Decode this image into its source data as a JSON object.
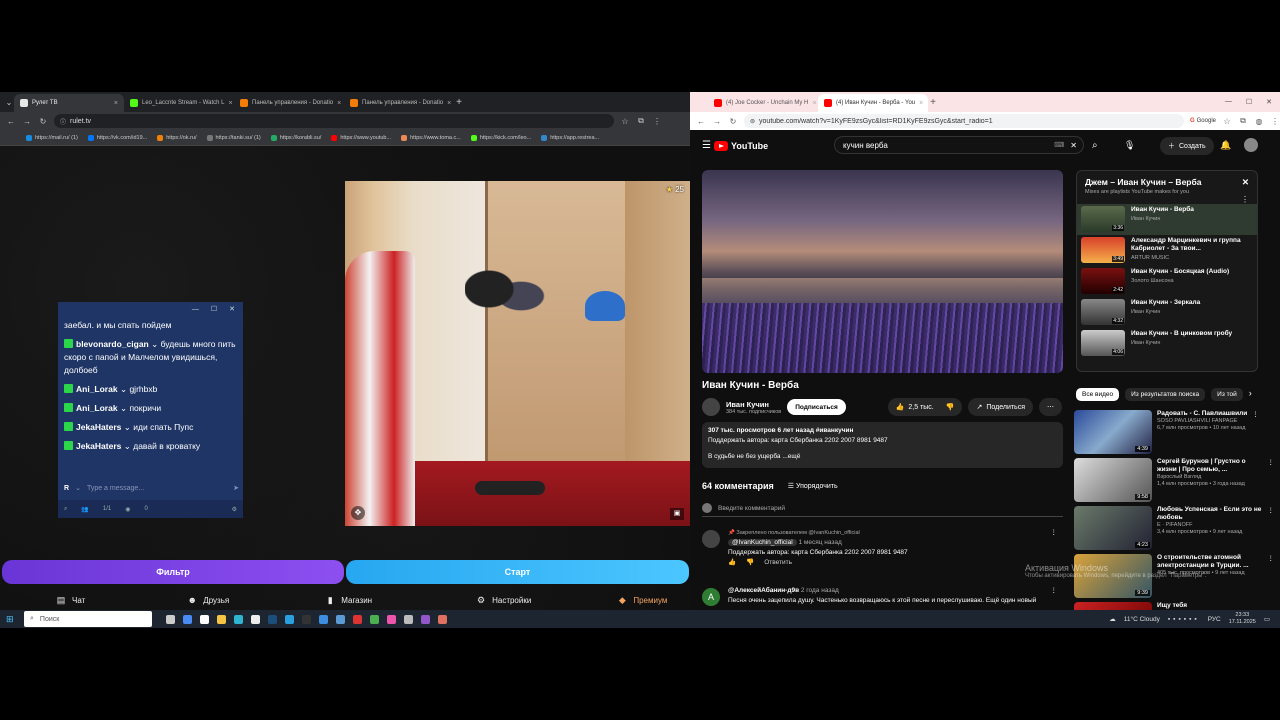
{
  "left_browser": {
    "tabs": [
      {
        "label": "Рулет ТВ",
        "color": "#e8e8e8"
      },
      {
        "label": "Leo_Laccnte Stream - Watch L",
        "color": "#53fc18"
      },
      {
        "label": "Панель управления - Donatio",
        "color": "#f57d07"
      },
      {
        "label": "Панель управления - Donatio",
        "color": "#f57d07"
      }
    ],
    "url": "rulet.tv",
    "bookmarks": [
      "https://mail.ru/ (1)",
      "https://vk.com/id19...",
      "https://ok.ru/",
      "https://tanki.su/ (1)",
      "https://korabli.su/",
      "https://www.youtub...",
      "https://www.toma.c...",
      "https://kick.com/leo...",
      "https://app.restrea..."
    ],
    "chat": {
      "messages": [
        {
          "user": "",
          "text": "заебал. и мы спать пойдем"
        },
        {
          "user": "blevonardo_cigan",
          "text": "будешь много пить скоро с папой и Малчелом увидишься, долбоеб"
        },
        {
          "user": "Ani_Lorak",
          "text": "gjrhbxb"
        },
        {
          "user": "Ani_Lorak",
          "text": "покричи"
        },
        {
          "user": "JekaHaters",
          "text": "иди спать Пупс"
        },
        {
          "user": "JekaHaters",
          "text": "давай в кроватку"
        }
      ],
      "input_badge": "R",
      "input_placeholder": "Type a message...",
      "viewers_count": "1/1",
      "eye_count": "0"
    },
    "video_star_count": "25",
    "btn_filter": "Фильтр",
    "btn_start": "Старт",
    "nav": [
      "Чат",
      "Друзья",
      "Магазин",
      "Настройки",
      "Премиум"
    ]
  },
  "right_browser": {
    "tabs": [
      {
        "label": "(4) Joe Cocker - Unchain My H",
        "color": "#ff0000"
      },
      {
        "label": "(4) Иван Кучин - Верба - You",
        "color": "#ff0000"
      }
    ],
    "url": "youtube.com/watch?v=1KyFE9zsGyc&list=RD1KyFE9zsGyc&start_radio=1",
    "google_label": "Google",
    "search_value": "кучин верба",
    "create_label": "Создать",
    "video_title": "Иван Кучин - Верба",
    "channel": "Иван Кучин",
    "subscribers": "384 тыс. подписчиков",
    "subscribe_label": "Подписаться",
    "likes": "2,5 тыс.",
    "share_label": "Поделиться",
    "desc_stats": "307 тыс. просмотров  6 лет назад  #иванкучин",
    "desc_line2": "Поддержать автора: карта Сбербанка 2202 2007 8981 9487",
    "desc_line3": "В судьбе не без ущерба ...ещё",
    "comments_count": "64 комментария",
    "sort_label": "Упорядочить",
    "comment_placeholder": "Введите комментарий",
    "pinned_label": "Закреплено пользователем @IvanKuchin_official",
    "pinned_user": "@IvanKuchin_official",
    "pinned_time": "1 месяц назад",
    "pinned_text": "Поддержать автора: карта Сбербанка 2202 2007 8981 9487",
    "reply_label": "Ответить",
    "comment2_user": "@АлексейАбанин-д9в",
    "comment2_time": "2 года назад",
    "comment2_text": "Песня очень зацепила душу. Частенько возвращаюсь к этой песне и переслушиваю. Ещё один новый",
    "playlist": {
      "title": "Джем – Иван Кучин – Верба",
      "subtitle": "Mixes are playlists YouTube makes for you",
      "items": [
        {
          "title": "Иван Кучин - Верба",
          "channel": "Иван Кучин",
          "duration": "3:36"
        },
        {
          "title": "Александр Марцинкевич и группа Кабриолет - За твои...",
          "channel": "ARTUR MUSIC",
          "duration": "3:49"
        },
        {
          "title": "Иван Кучин - Босяцкая (Audio)",
          "channel": "Золото Шансона",
          "duration": "2:42"
        },
        {
          "title": "Иван Кучин - Зеркала",
          "channel": "Иван Кучин",
          "duration": "4:32"
        },
        {
          "title": "Иван Кучин - В цинковом гробу",
          "channel": "Иван Кучин",
          "duration": "4:06"
        }
      ]
    },
    "chips": [
      "Все видео",
      "Из результатов поиска",
      "Из той"
    ],
    "recommendations": [
      {
        "title": "Радовать - С. Павлиашвили",
        "channel": "SOSO PAVLIASHVILI FANPAGE",
        "meta": "6,7 млн просмотров • 10 лет назад",
        "duration": "4:39"
      },
      {
        "title": "Сергей Бурунов | Грустно о жизни | Про семью, ...",
        "channel": "Взрослый Взгляд",
        "meta": "1,4 млн просмотров • 3 года назад",
        "duration": "9:58"
      },
      {
        "title": "Любовь Успенская - Если это не любовь",
        "channel": "E · PIFANOFF",
        "meta": "3,4 млн просмотров • 9 лет назад",
        "duration": "4:23"
      },
      {
        "title": "О строительстве атомной электростанции в Турции. ...",
        "channel": "",
        "meta": "405 тыс. просмотров • 9 лет назад",
        "duration": "9:39"
      },
      {
        "title": "Ищу тебя",
        "channel": "",
        "meta": "",
        "duration": ""
      }
    ],
    "activation_title": "Активация Windows",
    "activation_sub": "Чтобы активировать Windows, перейдите в раздел \"Параметры\"."
  },
  "taskbar": {
    "search_placeholder": "Поиск",
    "weather": "11°C  Cloudy",
    "lang": "РУС",
    "time": "23:33",
    "date": "17.11.2025"
  }
}
